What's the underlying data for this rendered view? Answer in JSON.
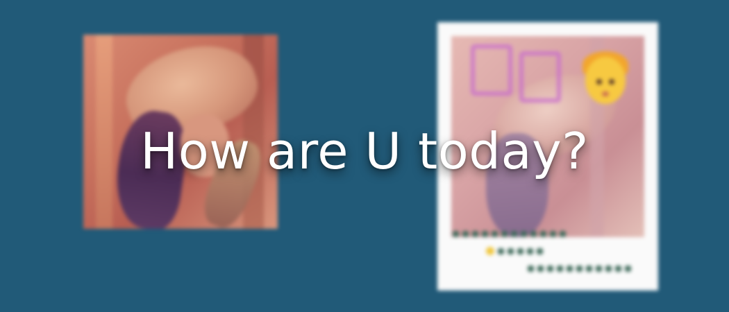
{
  "headline": {
    "text": "How are U today?"
  },
  "colors": {
    "background": "#215a78",
    "text": "#ffffff",
    "card": "#fafafa"
  },
  "images": {
    "left_photo": "blurred-portrait-photo",
    "right_card": "blurred-polaroid-card-with-emoji"
  }
}
